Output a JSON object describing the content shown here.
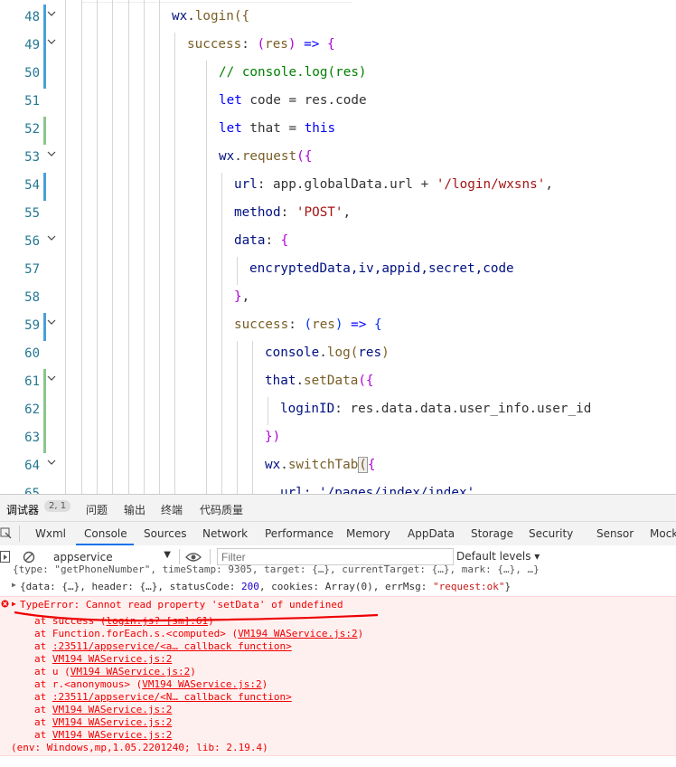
{
  "editor": {
    "lines": [
      {
        "num": "48",
        "marker": "blue",
        "fold": true
      },
      {
        "num": "49",
        "marker": "blue",
        "fold": true
      },
      {
        "num": "50",
        "marker": "blue",
        "fold": false
      },
      {
        "num": "51",
        "marker": "none",
        "fold": false
      },
      {
        "num": "52",
        "marker": "green",
        "fold": false
      },
      {
        "num": "53",
        "marker": "none",
        "fold": true
      },
      {
        "num": "54",
        "marker": "blue",
        "fold": false
      },
      {
        "num": "55",
        "marker": "none",
        "fold": false
      },
      {
        "num": "56",
        "marker": "none",
        "fold": true
      },
      {
        "num": "57",
        "marker": "none",
        "fold": false
      },
      {
        "num": "58",
        "marker": "none",
        "fold": false
      },
      {
        "num": "59",
        "marker": "blue",
        "fold": true
      },
      {
        "num": "60",
        "marker": "none",
        "fold": false
      },
      {
        "num": "61",
        "marker": "green",
        "fold": true
      },
      {
        "num": "62",
        "marker": "green",
        "fold": false
      },
      {
        "num": "63",
        "marker": "green",
        "fold": false
      },
      {
        "num": "64",
        "marker": "none",
        "fold": true
      },
      {
        "num": "65",
        "marker": "none",
        "fold": false
      }
    ],
    "code": {
      "l48": [
        "wx",
        ".",
        "login",
        "({"
      ],
      "l49": [
        "success",
        ": ",
        "(",
        "res",
        ")",
        " => ",
        "{"
      ],
      "l50": "// console.log(res)",
      "l51": [
        "let",
        " code = res.code"
      ],
      "l52": [
        "let",
        " that = ",
        "this"
      ],
      "l53": [
        "wx",
        ".",
        "request",
        "({"
      ],
      "l54": [
        "url",
        ": app.globalData.url + ",
        "'/login/wxsns'",
        ","
      ],
      "l55": [
        "method",
        ": ",
        "'POST'",
        ","
      ],
      "l56": [
        "data",
        ": ",
        "{"
      ],
      "l57": "encryptedData,iv,appid,secret,code",
      "l58": [
        "}",
        ","
      ],
      "l59": [
        "success",
        ": ",
        "(",
        "res",
        ")",
        " => ",
        "{"
      ],
      "l60": [
        "console",
        ".",
        "log",
        "(",
        "res",
        ")"
      ],
      "l61": [
        "that",
        ".",
        "setData",
        "({"
      ],
      "l62": [
        "loginID",
        ": res.data.data.user_info.user_id"
      ],
      "l63": "})",
      "l64": [
        "wx",
        ".",
        "switchTab",
        "(",
        "{"
      ],
      "l65": "url: '/pages/index/index'"
    }
  },
  "panel_tabs": {
    "debugger": "调试器",
    "badge": "2, 1",
    "issues": "问题",
    "output": "输出",
    "terminal": "终端",
    "quality": "代码质量"
  },
  "devtools_tabs": [
    "Wxml",
    "Console",
    "Sources",
    "Network",
    "Performance",
    "Memory",
    "AppData",
    "Storage",
    "Security",
    "Sensor",
    "Mock"
  ],
  "toolbar": {
    "context": "appservice",
    "filter_placeholder": "Filter",
    "levels": "Default levels ▾"
  },
  "console": {
    "truncated": "{type: \"getPhoneNumber\", timeStamp: 9305, target: {…}, currentTarget: {…}, mark: {…}, …}",
    "obj_prefix": "{data: {…}, header: {…}, statusCode: ",
    "status_code": "200",
    "obj_mid": ", cookies: Array(0), errMsg: ",
    "errmsg": "\"request:ok\"",
    "obj_end": "}",
    "error_title": "TypeError: Cannot read property 'setData' of undefined",
    "stack": [
      {
        "at": "at success (",
        "loc": "login.js? [sm]:61",
        "end": ")"
      },
      {
        "at": "at Function.forEach.s.<computed> (",
        "loc": "VM194 WAService.js:2",
        "end": ")"
      },
      {
        "at": "at ",
        "loc": ":23511/appservice/<a… callback function>",
        "end": ""
      },
      {
        "at": "at ",
        "loc": "VM194 WAService.js:2",
        "end": ""
      },
      {
        "at": "at u (",
        "loc": "VM194 WAService.js:2",
        "end": ")"
      },
      {
        "at": "at r.<anonymous> (",
        "loc": "VM194 WAService.js:2",
        "end": ")"
      },
      {
        "at": "at ",
        "loc": ":23511/appservice/<N… callback function>",
        "end": ""
      },
      {
        "at": "at ",
        "loc": "VM194 WAService.js:2",
        "end": ""
      },
      {
        "at": "at ",
        "loc": "VM194 WAService.js:2",
        "end": ""
      },
      {
        "at": "at ",
        "loc": "VM194 WAService.js:2",
        "end": ""
      }
    ],
    "env": "(env: Windows,mp,1.05.2201240; lib: 2.19.4)"
  },
  "colors": {
    "accent": "#1a73e8",
    "error_text": "#e00000",
    "error_bg": "#fff0f0",
    "gutter_blue": "#4a9fd8",
    "gutter_green": "#8bc58b"
  }
}
